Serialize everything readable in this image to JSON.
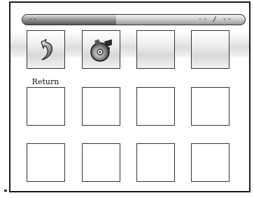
{
  "topbar": {
    "left_text": "--",
    "right_text": "-- / --",
    "progress": 0.42
  },
  "tiles": [
    {
      "label": "Return",
      "icon": "return-arrow-icon"
    },
    {
      "label": "",
      "icon": "music-cd-icon"
    },
    {
      "label": "",
      "icon": ""
    },
    {
      "label": "",
      "icon": ""
    },
    {
      "label": "",
      "icon": ""
    },
    {
      "label": "",
      "icon": ""
    },
    {
      "label": "",
      "icon": ""
    },
    {
      "label": "",
      "icon": ""
    },
    {
      "label": "",
      "icon": ""
    },
    {
      "label": "",
      "icon": ""
    },
    {
      "label": "",
      "icon": ""
    },
    {
      "label": "",
      "icon": ""
    }
  ]
}
